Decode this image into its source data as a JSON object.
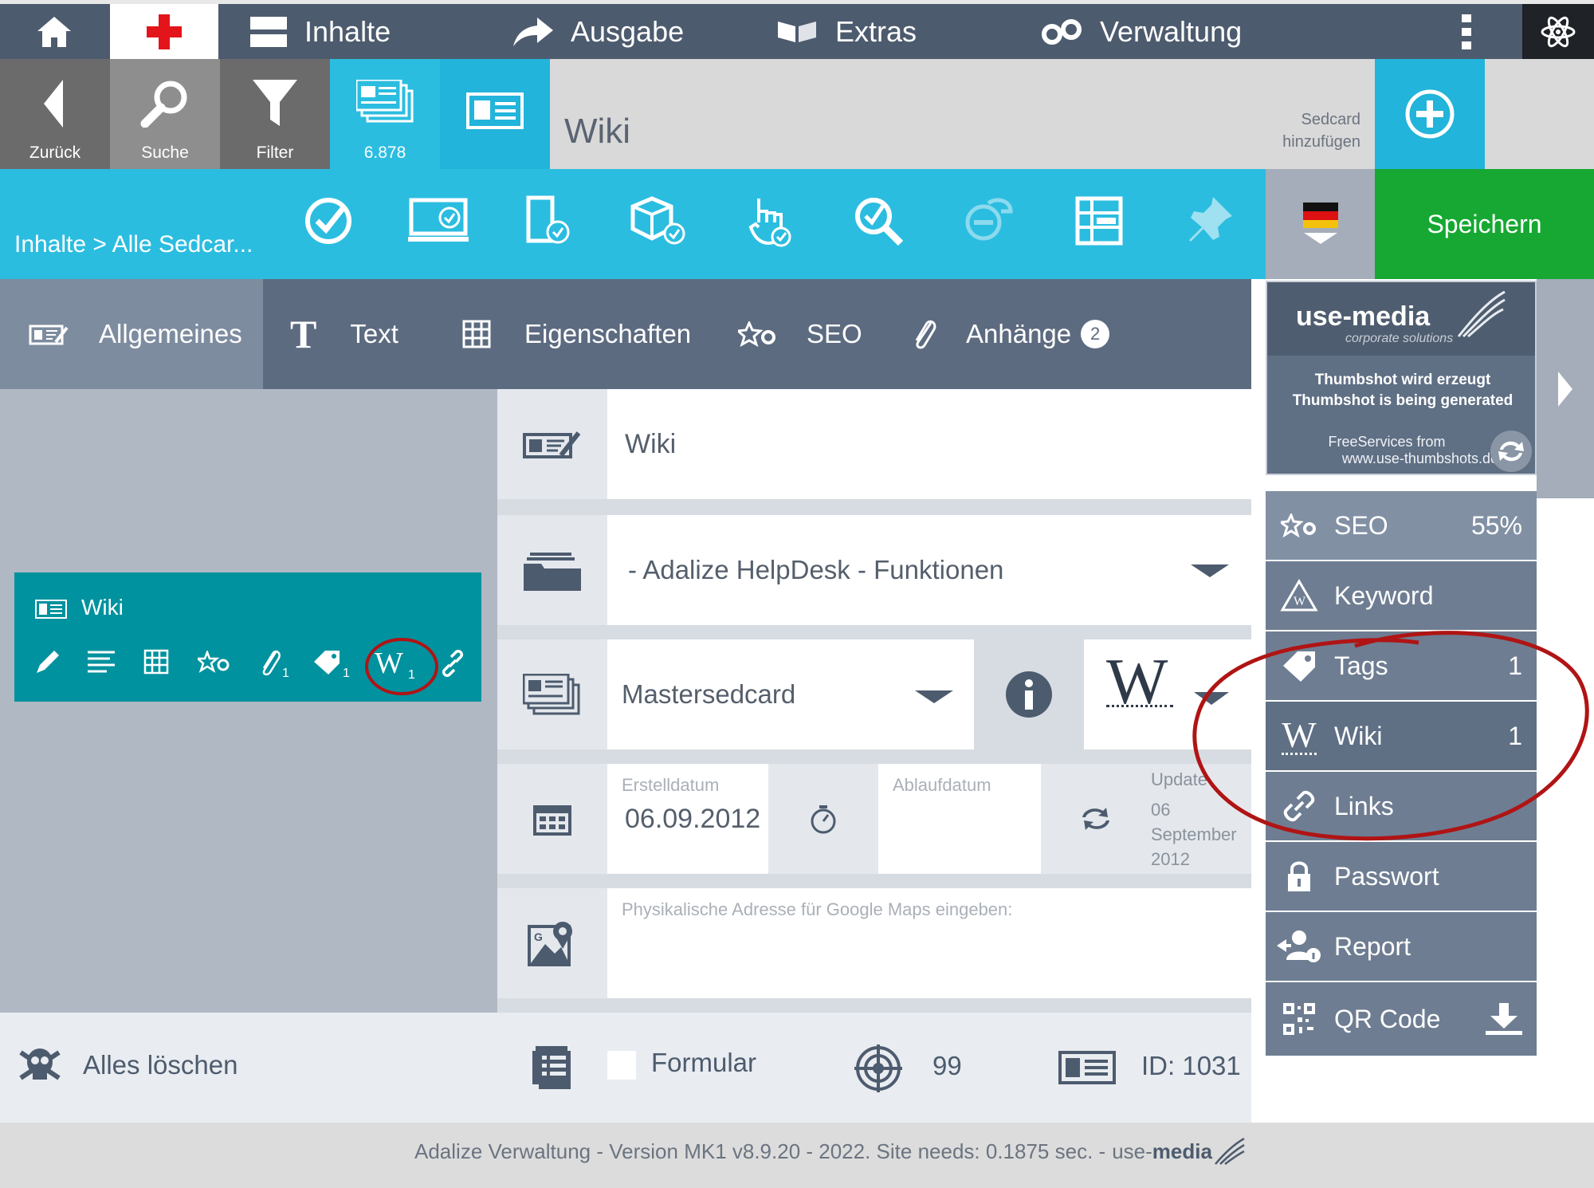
{
  "topnav": {
    "items": [
      {
        "label": "Inhalte",
        "icon": "content-icon"
      },
      {
        "label": "Ausgabe",
        "icon": "share-arrow-icon"
      },
      {
        "label": "Extras",
        "icon": "flags-icon"
      },
      {
        "label": "Verwaltung",
        "icon": "gears-icon"
      }
    ]
  },
  "toolbar": {
    "back_label": "Zurück",
    "search_label": "Suche",
    "filter_label": "Filter",
    "count_label": "6.878",
    "page_title": "Wiki",
    "add_sedcard_label_1": "Sedcard",
    "add_sedcard_label_2": "hinzufügen"
  },
  "breadcrumb": "Inhalte > Alle Sedcar...",
  "save_label": "Speichern",
  "tabs": [
    {
      "label": "Allgemeines"
    },
    {
      "label": "Text"
    },
    {
      "label": "Eigenschaften"
    },
    {
      "label": "SEO"
    },
    {
      "label": "Anhänge",
      "badge": "2"
    }
  ],
  "card": {
    "title": "Wiki",
    "attach_count": "1",
    "tag_count": "1",
    "wiki_count": "1"
  },
  "form": {
    "title_value": "Wiki",
    "category_value": "- Adalize HelpDesk - Funktionen",
    "master_value": "Mastersedcard",
    "created_label": "Erstelldatum",
    "created_value": "06.09.2012",
    "expiry_label": "Ablaufdatum",
    "update_label": "Update",
    "update_day": "06",
    "update_month": "September",
    "update_year": "2012",
    "address_placeholder": "Physikalische Adresse für Google Maps eingeben:"
  },
  "thumbnail": {
    "brand": "use-media",
    "brand_sub": "corporate solutions",
    "line1": "Thumbshot wird erzeugt",
    "line2": "Thumbshot is being generated",
    "line3": "FreeServices from",
    "line4": "www.use-thumbshots.de"
  },
  "sidebar": {
    "items": [
      {
        "label": "SEO",
        "value": "55%"
      },
      {
        "label": "Keyword",
        "value": ""
      },
      {
        "label": "Tags",
        "value": "1"
      },
      {
        "label": "Wiki",
        "value": "1"
      },
      {
        "label": "Links",
        "value": ""
      },
      {
        "label": "Passwort",
        "value": ""
      },
      {
        "label": "Report",
        "value": ""
      },
      {
        "label": "QR Code",
        "value": ""
      }
    ]
  },
  "bottom": {
    "delete_label": "Alles löschen",
    "form_label": "Formular",
    "target_value": "99",
    "id_label": "ID: 1031"
  },
  "footer": {
    "text": "Adalize Verwaltung - Version MK1 v8.9.20 - 2022. Site needs: 0.1875 sec. -",
    "brand_a": "use-",
    "brand_b": "media"
  },
  "colors": {
    "topbar": "#4d5b6e",
    "cyan": "#2bbde0",
    "teal": "#00929e",
    "save_green": "#16a832",
    "annotation_red": "#b01414"
  }
}
